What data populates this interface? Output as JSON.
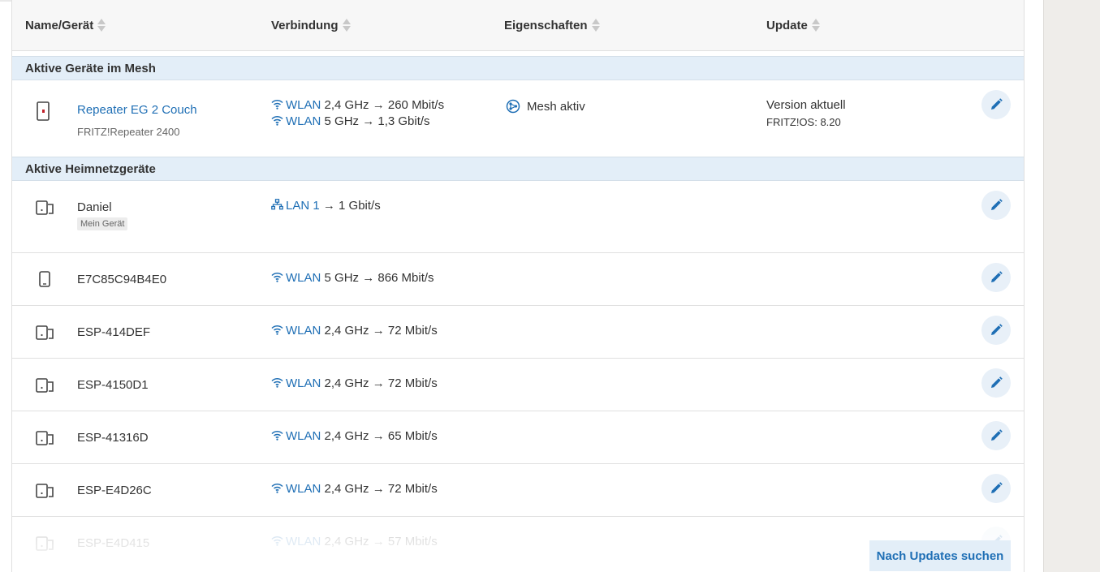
{
  "columns": {
    "name": "Name/Gerät",
    "connection": "Verbindung",
    "properties": "Eigenschaften",
    "update": "Update"
  },
  "sections": {
    "mesh": "Aktive Geräte im Mesh",
    "home": "Aktive Heimnetzgeräte"
  },
  "mesh_device": {
    "name": "Repeater EG 2 Couch",
    "model": "FRITZ!Repeater 2400",
    "conn1_type": "WLAN",
    "conn1_rest": "2,4 GHz → 260 Mbit/s",
    "conn2_type": "WLAN",
    "conn2_rest": "5 GHz → 1,3 Gbit/s",
    "property": "Mesh aktiv",
    "update_status": "Version aktuell",
    "update_version": "FRITZ!OS: 8.20"
  },
  "daniel": {
    "name": "Daniel",
    "badge": "Mein Gerät",
    "conn_type": "LAN 1",
    "conn_rest": "→ 1 Gbit/s"
  },
  "devices": [
    {
      "name": "E7C85C94B4E0",
      "conn_type": "WLAN",
      "conn_rest": "5 GHz → 866 Mbit/s",
      "icon": "phone-icon"
    },
    {
      "name": "ESP-414DEF",
      "conn_type": "WLAN",
      "conn_rest": "2,4 GHz → 72 Mbit/s",
      "icon": "device-icon"
    },
    {
      "name": "ESP-4150D1",
      "conn_type": "WLAN",
      "conn_rest": "2,4 GHz → 72 Mbit/s",
      "icon": "device-icon"
    },
    {
      "name": "ESP-41316D",
      "conn_type": "WLAN",
      "conn_rest": "2,4 GHz → 65 Mbit/s",
      "icon": "device-icon"
    },
    {
      "name": "ESP-E4D26C",
      "conn_type": "WLAN",
      "conn_rest": "2,4 GHz → 72 Mbit/s",
      "icon": "device-icon"
    },
    {
      "name": "ESP-E4D415",
      "conn_type": "WLAN",
      "conn_rest": "2,4 GHz → 57 Mbit/s",
      "icon": "device-icon"
    }
  ],
  "update_button": "Nach Updates suchen",
  "colors": {
    "accent": "#1f6fb5",
    "section_bg": "#e3eef8",
    "edit_bg": "#e8f0f8"
  }
}
